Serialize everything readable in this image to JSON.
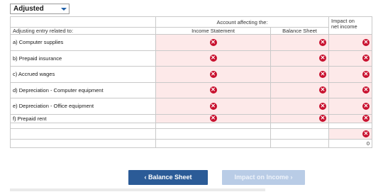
{
  "dropdown": {
    "value": "Adjusted"
  },
  "headers": {
    "account_affecting": "Account affecting the:",
    "impact_line1": "Impact on",
    "impact_line2": "net income",
    "entry_related": "Adjusting entry related to:",
    "income_statement": "Income Statement",
    "balance_sheet": "Balance Sheet"
  },
  "rows": [
    {
      "label": "a) Computer supplies"
    },
    {
      "label": "b) Prepaid insurance"
    },
    {
      "label": "c) Accrued wages"
    },
    {
      "label": "d) Depreciation - Computer equipment"
    },
    {
      "label": "e) Depreciation - Office equipment"
    },
    {
      "label": "f) Prepaid rent"
    }
  ],
  "total_value": "0",
  "buttons": {
    "prev": "Balance Sheet",
    "next": "Impact on Income"
  },
  "icons": {
    "invalid": "x-circle-icon",
    "prev_arrow": "chevron-left-icon",
    "next_arrow": "chevron-right-icon"
  },
  "colors": {
    "invalid": "#c8102e",
    "input_bg": "#fde9e9",
    "btn_primary": "#2b5b97",
    "btn_disabled": "#b9cce6"
  }
}
